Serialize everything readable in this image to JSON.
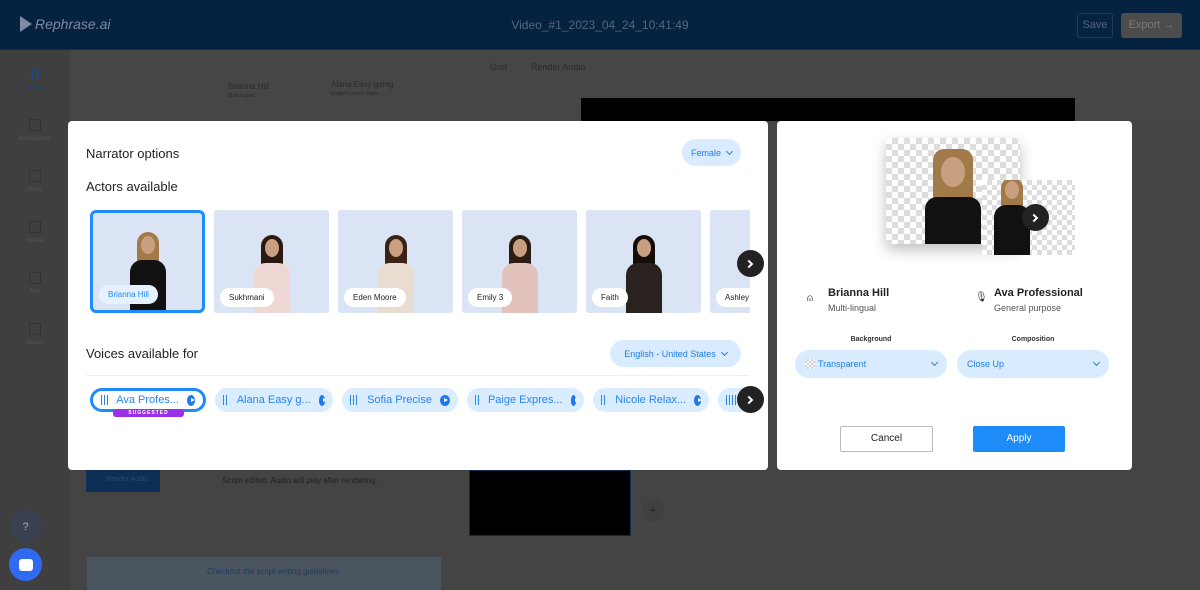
{
  "header": {
    "logo": "Rephrase.ai",
    "title": "Video_#1_2023_04_24_10:41:49",
    "save": "Save",
    "export": "Export →"
  },
  "sidebar": {
    "items": [
      {
        "label": "Script",
        "icon": "waveform-icon"
      },
      {
        "label": "Background",
        "icon": "image-icon"
      },
      {
        "label": "Music",
        "icon": "music-icon"
      },
      {
        "label": "Media",
        "icon": "media-icon"
      },
      {
        "label": "Text",
        "icon": "text-icon"
      },
      {
        "label": "Shapes",
        "icon": "square-icon"
      }
    ]
  },
  "editor": {
    "actor": "Brianna Hill",
    "actor_sub": "Multi-lingual",
    "voice": "Alana Easy going",
    "voice_sub": "English-United States",
    "grid": "Grid",
    "render_audio": "Render Audio",
    "render_audio_btn": "Render Audio",
    "script_status": "Script edited. Audio will play after rendering.",
    "guidelines": "Checkout the script writing guidelines"
  },
  "modal": {
    "title": "Narrator options",
    "gender_filter": "Female",
    "actors_heading": "Actors available",
    "actors": [
      {
        "name": "Brianna Hill",
        "selected": true
      },
      {
        "name": "Sukhmani"
      },
      {
        "name": "Eden Moore"
      },
      {
        "name": "Emily 3"
      },
      {
        "name": "Faith"
      },
      {
        "name": "Ashley"
      }
    ],
    "voices_heading": "Voices available for",
    "language": "English - United States",
    "voices": [
      {
        "name": "Ava Profes...",
        "selected": true,
        "badge": "SUGGESTED"
      },
      {
        "name": "Alana Easy g..."
      },
      {
        "name": "Sofia Precise"
      },
      {
        "name": "Paige Expres..."
      },
      {
        "name": "Nicole Relax..."
      }
    ]
  },
  "panel": {
    "actor_name": "Brianna Hill",
    "actor_sub": "Multi-lingual",
    "voice_name": "Ava Professional",
    "voice_sub": "General purpose",
    "background_label": "Background",
    "background_value": "Transparent",
    "composition_label": "Composition",
    "composition_value": "Close Up",
    "cancel": "Cancel",
    "apply": "Apply"
  },
  "help": "?",
  "colors": {
    "accent": "#1d8cf8",
    "suggested": "#9b30e8",
    "header": "#0a3a6e"
  }
}
